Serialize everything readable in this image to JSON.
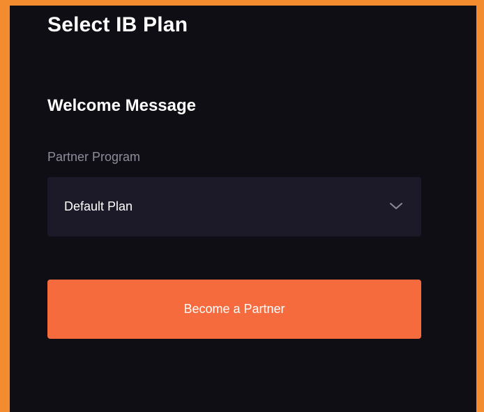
{
  "page": {
    "title": "Select IB Plan"
  },
  "form": {
    "section_title": "Welcome Message",
    "partner_program_label": "Partner Program",
    "partner_program_value": "Default Plan",
    "submit_label": "Become a Partner"
  },
  "icons": {
    "dropdown": "chevron-down-icon"
  },
  "colors": {
    "outer_border": "#f28c2e",
    "background": "#0f0e15",
    "field_background": "#1c1a28",
    "accent": "#f56b3d",
    "label_text": "#8e8c99"
  }
}
